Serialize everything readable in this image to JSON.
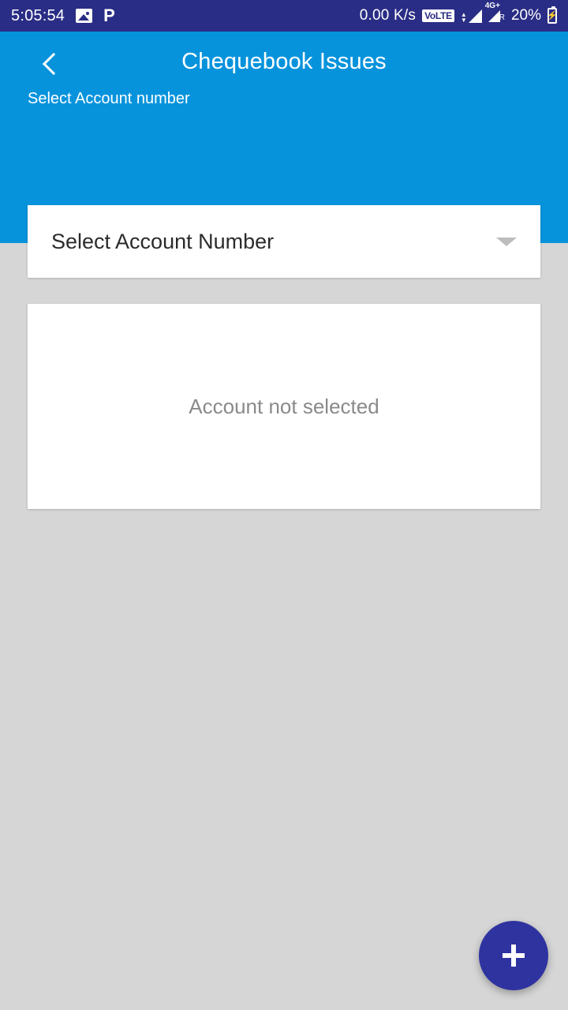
{
  "status_bar": {
    "clock": "5:05:54",
    "network_speed": "0.00 K/s",
    "volte_label": "VoLTE",
    "network_type": "4G+",
    "roaming_label": "R",
    "battery_percent": "20%",
    "icons": [
      "photo-icon",
      "phonepe-icon",
      "volte-icon",
      "signal-icon",
      "signal-roaming-icon",
      "battery-charging-icon"
    ],
    "background_color": "#2a2d85",
    "text_color": "#ffffff"
  },
  "header": {
    "back_label": "Back",
    "title": "Chequebook Issues",
    "subtitle": "Select Account number",
    "background_color": "#0793dc",
    "text_color": "#ffffff"
  },
  "account_selector": {
    "label": "Select Account Number",
    "dropdown_icon": "chevron-down-icon",
    "text_color": "#2b2b2b",
    "background_color": "#ffffff"
  },
  "content": {
    "empty_message": "Account not selected",
    "text_color": "#8a8a8a",
    "background_color": "#ffffff"
  },
  "fab": {
    "label": "+",
    "icon": "plus-icon",
    "background_color": "#2f33a0",
    "icon_color": "#ffffff"
  },
  "page": {
    "background_color": "#d6d6d6"
  }
}
